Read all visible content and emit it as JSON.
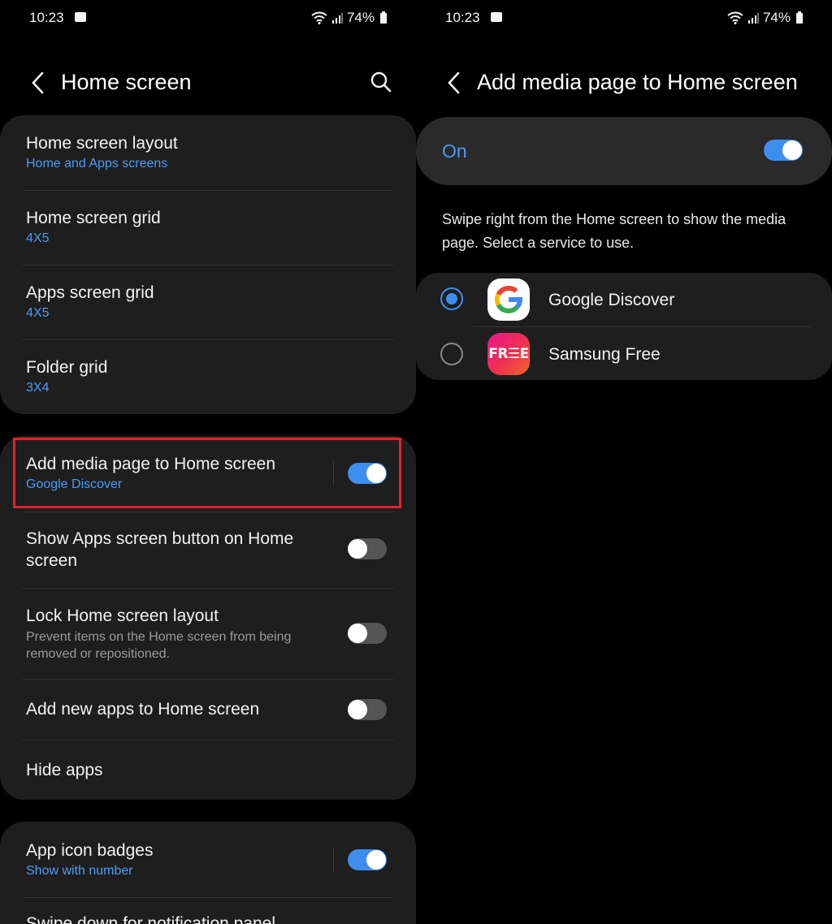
{
  "status": {
    "time": "10:23",
    "battery": "74%"
  },
  "left": {
    "title": "Home screen",
    "group1": [
      {
        "label": "Home screen layout",
        "sub": "Home and Apps screens"
      },
      {
        "label": "Home screen grid",
        "sub": "4X5"
      },
      {
        "label": "Apps screen grid",
        "sub": "4X5"
      },
      {
        "label": "Folder grid",
        "sub": "3X4"
      }
    ],
    "group2": [
      {
        "label": "Add media page to Home screen",
        "sub": "Google Discover",
        "toggle": "on"
      },
      {
        "label": "Show Apps screen button on Home screen",
        "toggle": "off"
      },
      {
        "label": "Lock Home screen layout",
        "desc": "Prevent items on the Home screen from being removed or repositioned.",
        "toggle": "off"
      },
      {
        "label": "Add new apps to Home screen",
        "toggle": "off"
      },
      {
        "label": "Hide apps"
      }
    ],
    "group3": [
      {
        "label": "App icon badges",
        "sub": "Show with number",
        "toggle": "on"
      },
      {
        "label": "Swipe down for notification panel"
      }
    ]
  },
  "right": {
    "title": "Add media page to Home screen",
    "master_label": "On",
    "master_toggle": "on",
    "explanation": "Swipe right from the Home screen to show the media page. Select a service to use.",
    "services": [
      {
        "name": "Google Discover",
        "icon": "google-g-icon",
        "selected": true
      },
      {
        "name": "Samsung Free",
        "icon": "samsung-free-icon",
        "icon_text": "FR☰E",
        "selected": false
      }
    ]
  },
  "colors": {
    "accent": "#3e8ef0",
    "link": "#4a9bf5",
    "card": "#1e1e1e",
    "highlight": "#e0232e"
  }
}
